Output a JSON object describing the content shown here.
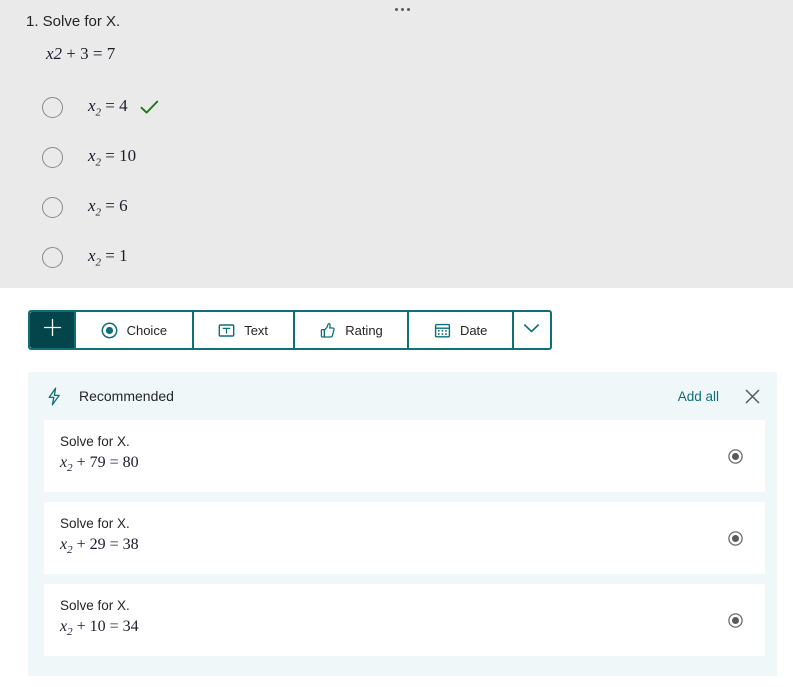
{
  "colors": {
    "question_card_bg": "#eaeaea",
    "toolbar_border": "#0d7078",
    "toolbar_add_bg": "#03454a",
    "accent_teal": "#0f6c7a",
    "panel_bg": "#eff7f8",
    "check_green": "#107c10",
    "radio_gray": "#5a5a5a"
  },
  "question": {
    "overflow_menu_icon": "ellipsis-horizontal-icon",
    "number_and_title": "1. Solve for X.",
    "equation_var": "x2",
    "equation_rest": " + 3 = 7",
    "choices": [
      {
        "var": "x",
        "sub": "2",
        "rest": " = 4",
        "correct": true,
        "check_icon": "checkmark-icon"
      },
      {
        "var": "x",
        "sub": "2",
        "rest": " = 10",
        "correct": false
      },
      {
        "var": "x",
        "sub": "2",
        "rest": " = 6",
        "correct": false
      },
      {
        "var": "x",
        "sub": "2",
        "rest": " = 1",
        "correct": false
      }
    ]
  },
  "toolbar": {
    "add_label": "+",
    "add_icon": "plus-icon",
    "items": [
      {
        "label": "Choice",
        "icon": "radio-button-icon"
      },
      {
        "label": "Text",
        "icon": "text-box-icon"
      },
      {
        "label": "Rating",
        "icon": "thumbs-up-icon"
      },
      {
        "label": "Date",
        "icon": "calendar-icon"
      }
    ],
    "more_icon": "chevron-down-icon"
  },
  "recommended": {
    "icon": "lightning-bolt-icon",
    "title": "Recommended",
    "add_all_label": "Add all",
    "close_icon": "close-icon",
    "cards": [
      {
        "title": "Solve for X.",
        "var": "x",
        "sub": "2",
        "rest": " + 79 = 80",
        "action_icon": "radio-button-icon"
      },
      {
        "title": "Solve for X.",
        "var": "x",
        "sub": "2",
        "rest": " + 29 = 38",
        "action_icon": "radio-button-icon"
      },
      {
        "title": "Solve for X.",
        "var": "x",
        "sub": "2",
        "rest": " + 10 = 34",
        "action_icon": "radio-button-icon"
      }
    ]
  }
}
